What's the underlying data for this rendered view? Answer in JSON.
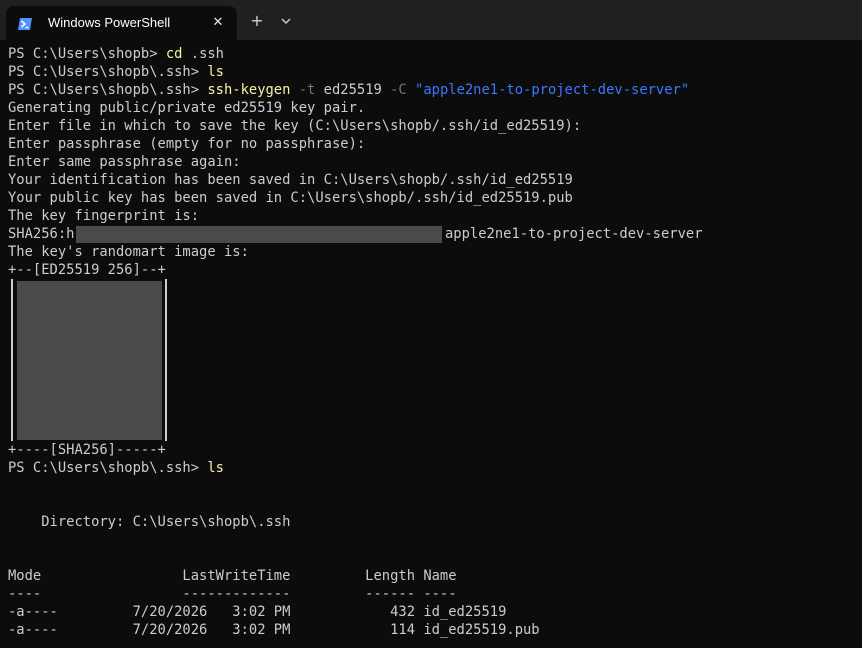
{
  "window": {
    "tab_title": "Windows PowerShell",
    "close_glyph": "✕",
    "new_tab_glyph": "+",
    "icons": {
      "app": "powershell-icon",
      "close": "close-icon",
      "new_tab": "plus-icon",
      "dropdown": "chevron-down-icon"
    }
  },
  "colors": {
    "background": "#0c0c0c",
    "text": "#cccccc",
    "command": "#f9f1a5",
    "param": "#767676",
    "string": "#3b78ff",
    "titlebar": "#202020"
  },
  "terminal": {
    "prompt1": "PS C:\\Users\\shopb> ",
    "cmd1": "cd",
    "arg1": " .ssh",
    "prompt2": "PS C:\\Users\\shopb\\.ssh> ",
    "cmd2": "ls",
    "prompt3": "PS C:\\Users\\shopb\\.ssh> ",
    "cmd3": "ssh-keygen",
    "flag3a": " -t",
    "arg3": " ed25519",
    "flag3b": " -C",
    "str3": " \"apple2ne1-to-project-dev-server\"",
    "out": [
      "Generating public/private ed25519 key pair.",
      "Enter file in which to save the key (C:\\Users\\shopb/.ssh/id_ed25519):",
      "Enter passphrase (empty for no passphrase):",
      "Enter same passphrase again:",
      "Your identification has been saved in C:\\Users\\shopb/.ssh/id_ed25519",
      "Your public key has been saved in C:\\Users\\shopb/.ssh/id_ed25519.pub",
      "The key fingerprint is:"
    ],
    "fingerprint_prefix": "SHA256:h",
    "fingerprint_comment": "apple2ne1-to-project-dev-server",
    "randomart_label": "The key's randomart image is:",
    "randomart_top": "+--[ED25519 256]--+",
    "randomart_bottom": "+----[SHA256]-----+",
    "prompt4": "PS C:\\Users\\shopb\\.ssh> ",
    "cmd4": "ls",
    "directory": "    Directory: C:\\Users\\shopb\\.ssh",
    "header": "Mode                 LastWriteTime         Length Name",
    "underline": "----                 -------------         ------ ----",
    "rows": [
      "-a----         7/20/2026   3:02 PM            432 id_ed25519",
      "-a----         7/20/2026   3:02 PM            114 id_ed25519.pub"
    ]
  }
}
